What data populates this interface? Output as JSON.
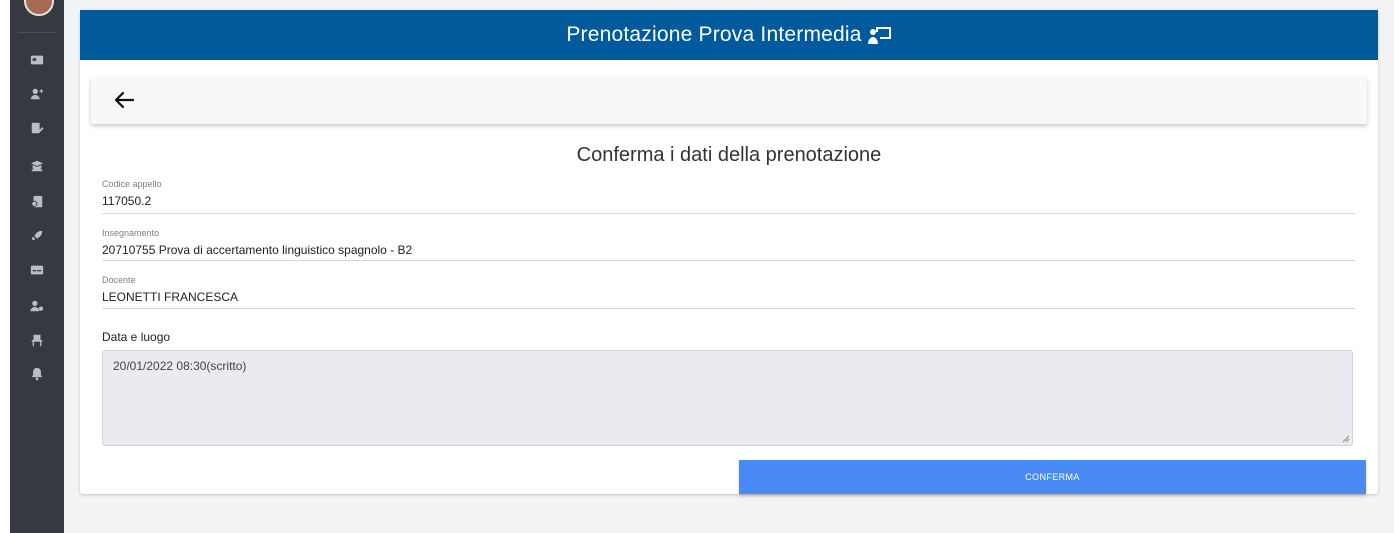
{
  "header": {
    "title": "Prenotazione Prova Intermedia",
    "icon": "presentation-icon",
    "color": "#005a9c"
  },
  "sidebar": {
    "items": [
      {
        "icon": "id-card-icon"
      },
      {
        "icon": "user-plus-icon"
      },
      {
        "icon": "edit-document-icon"
      },
      {
        "icon": "graduation-cap-icon"
      },
      {
        "icon": "certificate-icon"
      },
      {
        "icon": "rocket-icon"
      },
      {
        "icon": "card-icon"
      },
      {
        "icon": "user-cog-icon"
      },
      {
        "icon": "chair-icon"
      },
      {
        "icon": "bell-icon"
      }
    ]
  },
  "page": {
    "subtitle": "Conferma i dati della prenotazione"
  },
  "fields": [
    {
      "label": "Codice appello",
      "value": "117050.2"
    },
    {
      "label": "Insegnamento",
      "value": "20710755 Prova di accertamento linguistico spagnolo - B2"
    },
    {
      "label": "Docente",
      "value": "LEONETTI FRANCESCA"
    }
  ],
  "date_place": {
    "label": "Data e luogo",
    "value": "20/01/2022 08:30(scritto)"
  },
  "confirm": {
    "label": "CONFERMA",
    "color": "#4a8af4"
  }
}
